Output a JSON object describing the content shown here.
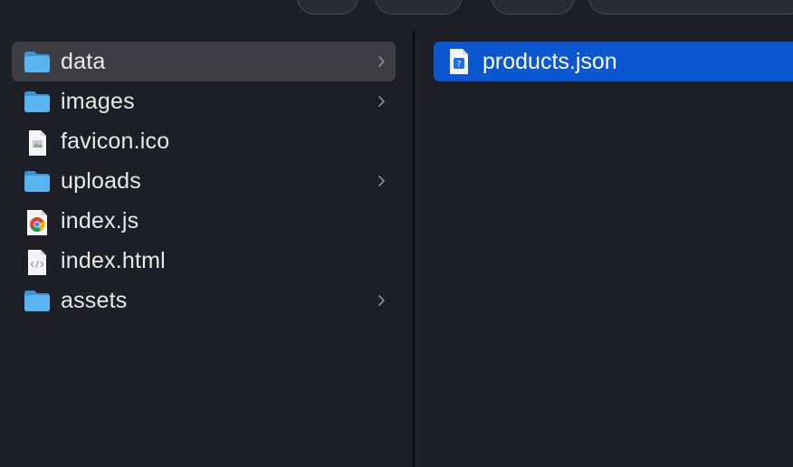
{
  "left_column": {
    "items": [
      {
        "label": "data",
        "icon": "folder-icon",
        "is_folder": true,
        "selected": true
      },
      {
        "label": "images",
        "icon": "folder-icon",
        "is_folder": true,
        "selected": false
      },
      {
        "label": "favicon.ico",
        "icon": "image-file-icon",
        "is_folder": false,
        "selected": false
      },
      {
        "label": "uploads",
        "icon": "folder-icon",
        "is_folder": true,
        "selected": false
      },
      {
        "label": "index.js",
        "icon": "chrome-document-icon",
        "is_folder": false,
        "selected": false
      },
      {
        "label": "index.html",
        "icon": "code-file-icon",
        "is_folder": false,
        "selected": false
      },
      {
        "label": "assets",
        "icon": "folder-icon",
        "is_folder": true,
        "selected": false
      }
    ]
  },
  "right_column": {
    "items": [
      {
        "label": "products.json",
        "icon": "json-file-icon",
        "selected": true
      }
    ]
  },
  "colors": {
    "background": "#1e1e26",
    "selection_active": "#0a57d0",
    "selection_inactive": "#3d3d43",
    "folder": "#5ab4ef"
  }
}
